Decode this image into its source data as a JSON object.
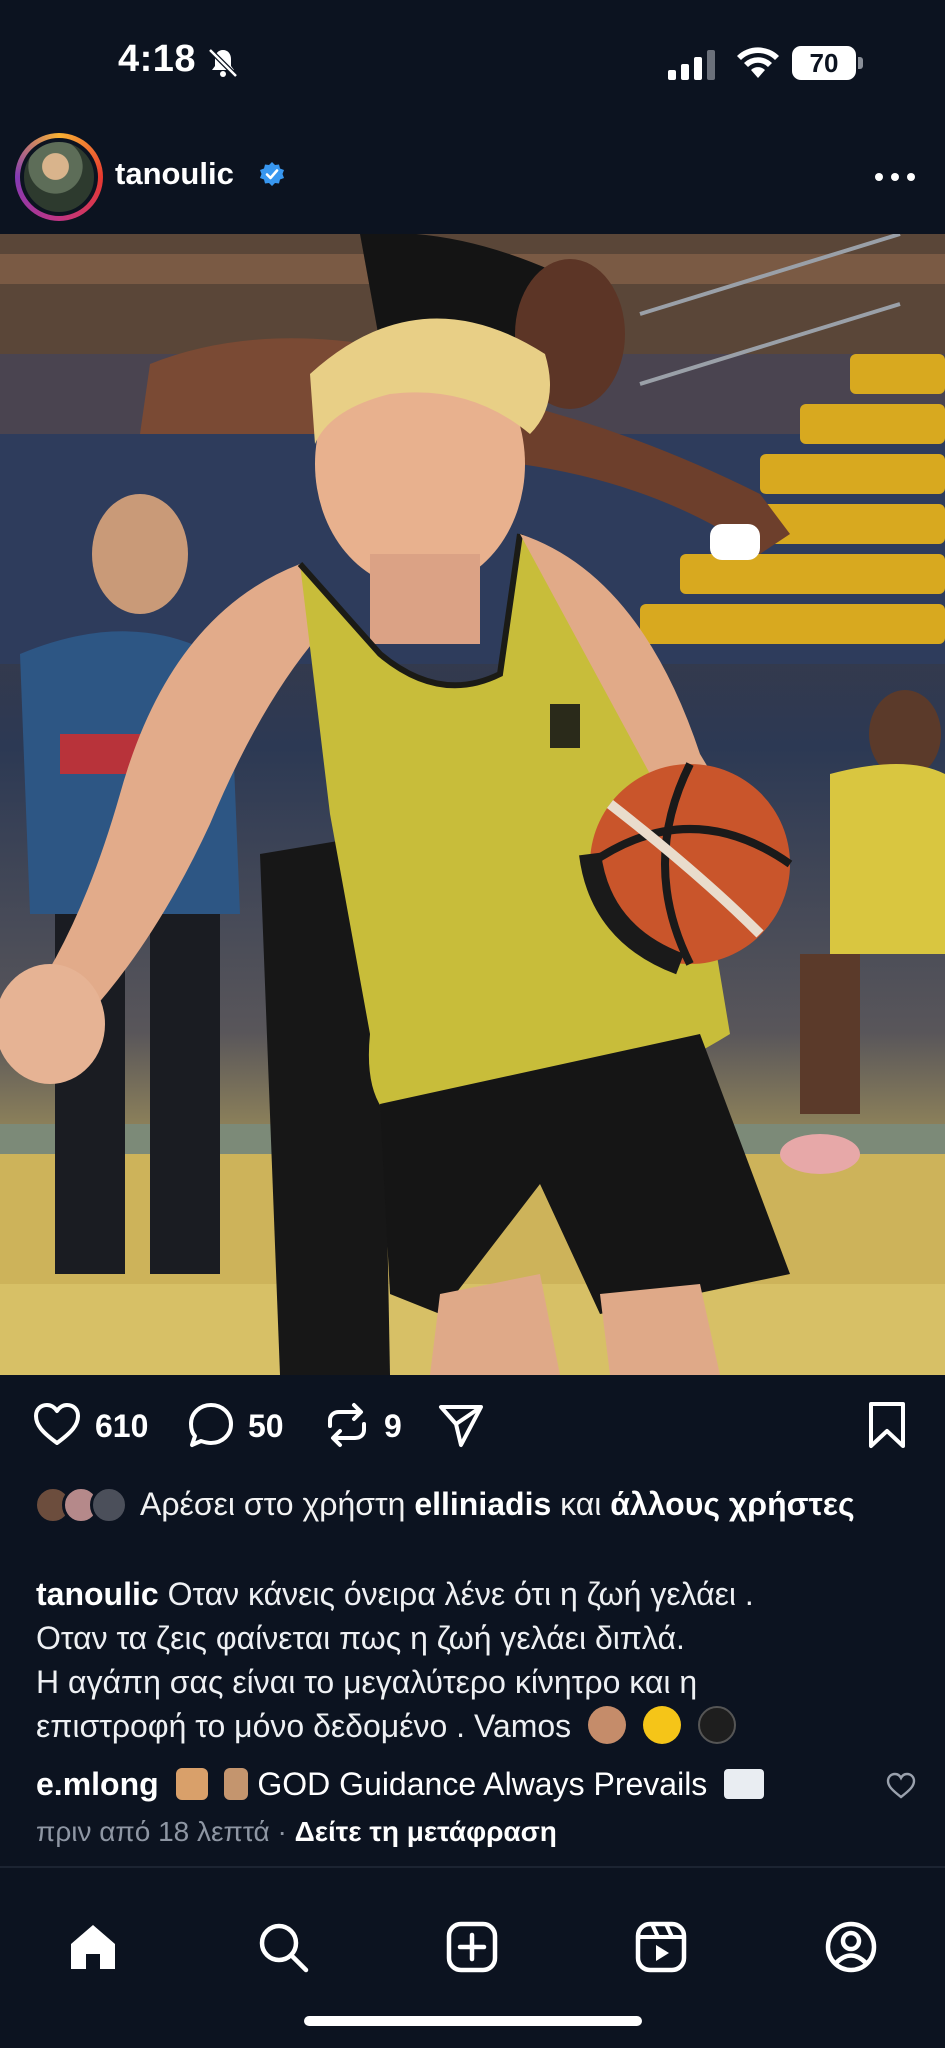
{
  "status_bar": {
    "time": "4:18",
    "battery": "70",
    "icons": [
      "bell-off-icon",
      "cellular-signal-icon",
      "wifi-icon",
      "battery-icon"
    ]
  },
  "post": {
    "username": "tanoulic",
    "verified": true,
    "counts": {
      "likes": "610",
      "comments": "50",
      "reposts": "9"
    },
    "liked_by": {
      "prefix": "Αρέσει στο χρήστη",
      "user": "elliniadis",
      "connector": "και",
      "others": "άλλους χρήστες"
    },
    "caption": {
      "user": "tanoulic",
      "line1": "Οταν κάνεις όνειρα λένε ότι η ζωή γελάει .",
      "line2": "Οταν τα ζεις φαίνεται πως η ζωή γελάει διπλά.",
      "line3": "Η αγάπη σας είναι το μεγαλύτερο κίνητρο και η",
      "line4": "επιστροφή το μόνο δεδομένο . Vamos"
    },
    "comment": {
      "user": "e.mlong",
      "text": "GOD Guidance Always Prevails"
    },
    "meta": {
      "time": "πριν από 18 λεπτά",
      "separator": "·",
      "translate": "Δείτε τη μετάφραση"
    }
  },
  "colors": {
    "background": "#0c1320",
    "verified_blue": "#3897f0",
    "muted_text": "#8e96a3"
  },
  "nav": [
    "home-icon",
    "search-icon",
    "create-icon",
    "reels-icon",
    "profile-icon"
  ]
}
